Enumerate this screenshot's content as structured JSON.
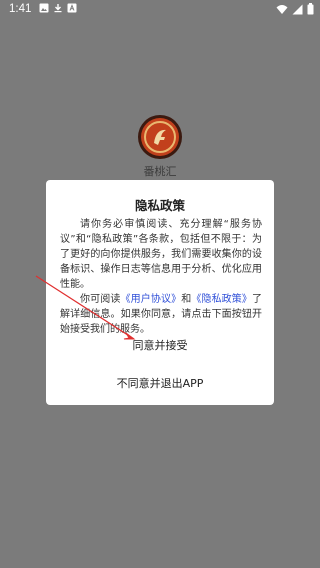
{
  "status_bar": {
    "time": "1:41",
    "icons_left": [
      "image-icon",
      "download-icon",
      "text-icon"
    ],
    "icons_right": [
      "wifi-icon",
      "signal-icon",
      "battery-icon"
    ]
  },
  "app": {
    "name": "番桃汇"
  },
  "dialog": {
    "title": "隐私政策",
    "paragraph1": "请你务必审慎阅读、充分理解“服务协议”和“隐私政策”各条款，包括但不限于：为了更好的向你提供服务，我们需要收集你的设备标识、操作日志等信息用于分析、优化应用性能。",
    "paragraph2_prefix": "你可阅读",
    "link_user_agreement": "《用户协议》",
    "and": "和",
    "link_privacy_policy": "《隐私政策》",
    "paragraph2_suffix": "了解详细信息。如果你同意，请点击下面按钮开始接受我们的服务。",
    "accept_label": "同意并接受",
    "decline_label": "不同意并退出APP"
  },
  "colors": {
    "scrim": "#7b7b7b",
    "link": "#3050d8",
    "arrow": "#e03030",
    "logo_red": "#c2401c"
  }
}
